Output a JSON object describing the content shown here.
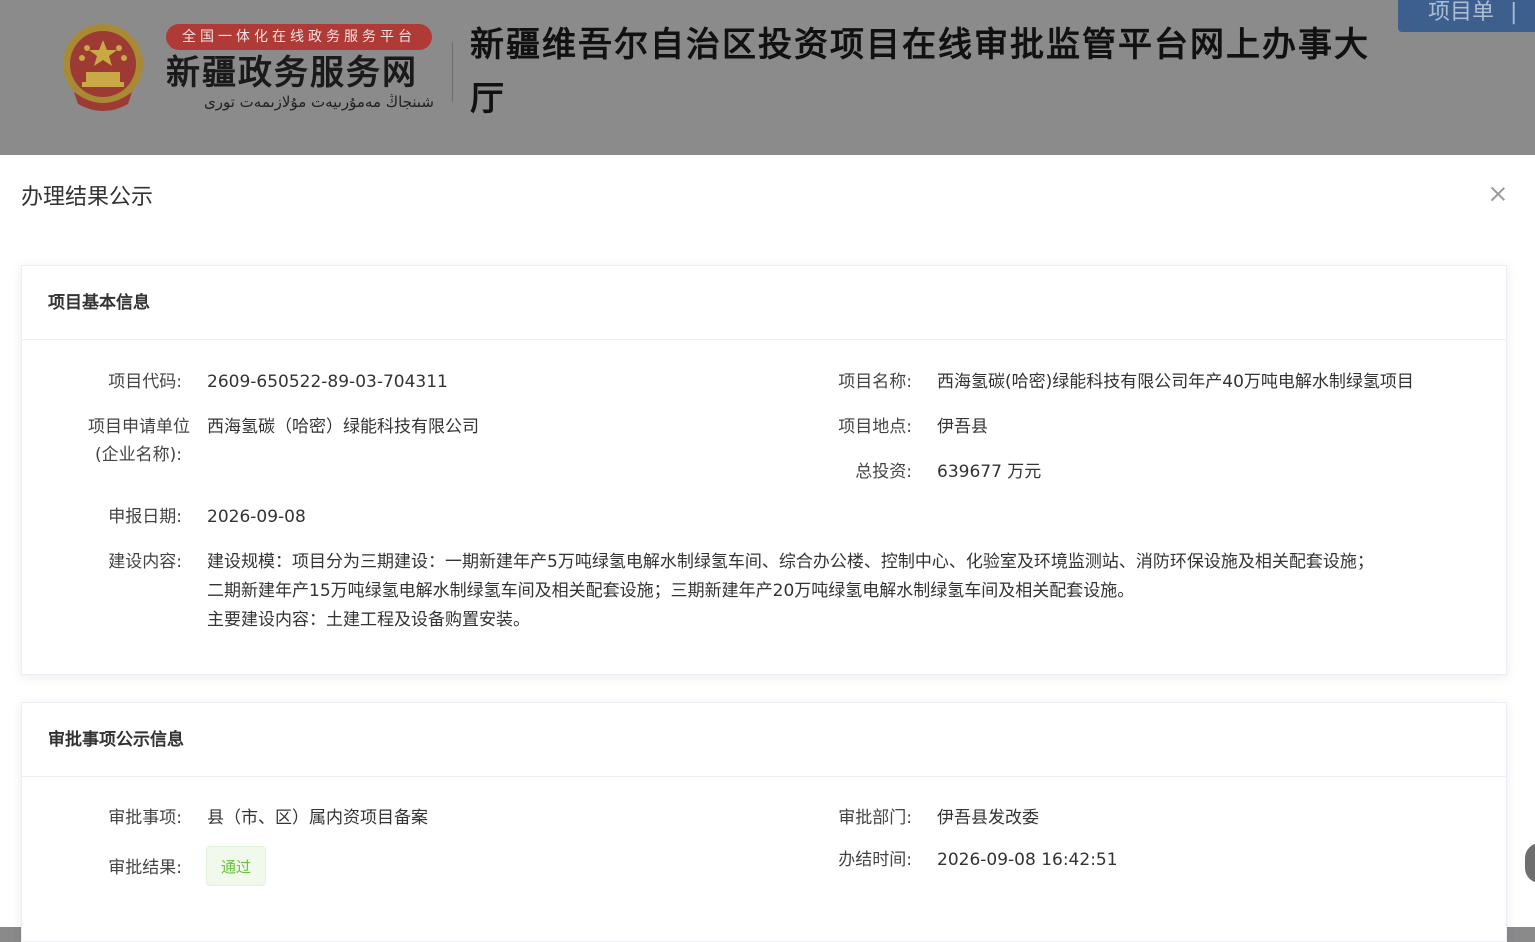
{
  "header": {
    "badge": "全国一体化在线政务服务平台",
    "site_name": "新疆政务服务网",
    "site_sub": "شىنجاڭ مەمۇرىيەت مۇلازىمەت تورى",
    "title": "新疆维吾尔自治区投资项目在线审批监管平台网上办事大厅",
    "top_button": "项目单",
    "top_button_sep": "|"
  },
  "modal": {
    "title": "办理结果公示",
    "close_icon": "close-icon"
  },
  "basic_info": {
    "section_title": "项目基本信息",
    "project_code_label": "项目代码:",
    "project_code": "2609-650522-89-03-704311",
    "project_name_label": "项目名称:",
    "project_name": "西海氢碳(哈密)绿能科技有限公司年产40万吨电解水制绿氢项目",
    "applicant_label_1": "项目申请单位",
    "applicant_label_2": "(企业名称):",
    "applicant": "西海氢碳（哈密）绿能科技有限公司",
    "location_label": "项目地点:",
    "location": "伊吾县",
    "investment_label": "总投资:",
    "investment": "639677 万元",
    "date_label": "申报日期:",
    "date": "2026-09-08",
    "content_label": "建设内容:",
    "content_line_1": "建设规模：项目分为三期建设：一期新建年产5万吨绿氢电解水制绿氢车间、综合办公楼、控制中心、化验室及环境监测站、消防环保设施及相关配套设施；",
    "content_line_2": "二期新建年产15万吨绿氢电解水制绿氢车间及相关配套设施；三期新建年产20万吨绿氢电解水制绿氢车间及相关配套设施。",
    "content_line_3": "主要建设内容：土建工程及设备购置安装。"
  },
  "approval_info": {
    "section_title": "审批事项公示信息",
    "item_label": "审批事项:",
    "item": "县（市、区）属内资项目备案",
    "dept_label": "审批部门:",
    "dept": "伊吾县发改委",
    "result_label": "审批结果:",
    "result": "通过",
    "time_label": "办结时间:",
    "time": "2026-09-08 16:42:51"
  },
  "colors": {
    "overlay_gray": "#8b8b8b",
    "badge_red": "#b03a36",
    "pass_green": "#67c23a",
    "pass_bg": "#f0f9eb",
    "top_button_blue": "#3d5f8e"
  }
}
